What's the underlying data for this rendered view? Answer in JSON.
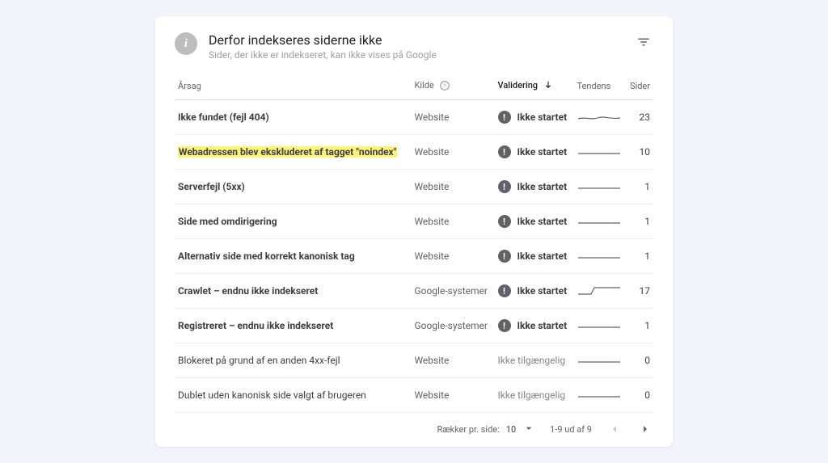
{
  "header": {
    "title": "Derfor indekseres siderne ikke",
    "subtitle": "Sider, der ikke er indekseret, kan ikke vises på Google"
  },
  "columns": {
    "reason": "Årsag",
    "source": "Kilde",
    "validation": "Validering",
    "trend": "Tendens",
    "pages": "Sider"
  },
  "status_labels": {
    "not_started": "Ikke startet",
    "na": "Ikke tilgængelig"
  },
  "sources": {
    "website": "Website",
    "google": "Google-systemer"
  },
  "rows": [
    {
      "reason": "Ikke fundet (fejl 404)",
      "bold": true,
      "highlight": false,
      "source": "website",
      "status": "not_started",
      "trend": "wavy",
      "pages": 23
    },
    {
      "reason": "Webadressen blev ekskluderet af tagget \"noindex\"",
      "bold": true,
      "highlight": true,
      "source": "website",
      "status": "not_started",
      "trend": "flat",
      "pages": 10
    },
    {
      "reason": "Serverfejl (5xx)",
      "bold": true,
      "highlight": false,
      "source": "website",
      "status": "not_started",
      "trend": "flat",
      "pages": 1
    },
    {
      "reason": "Side med omdirigering",
      "bold": true,
      "highlight": false,
      "source": "website",
      "status": "not_started",
      "trend": "flat",
      "pages": 1
    },
    {
      "reason": "Alternativ side med korrekt kanonisk tag",
      "bold": true,
      "highlight": false,
      "source": "website",
      "status": "not_started",
      "trend": "flat",
      "pages": 1
    },
    {
      "reason": "Crawlet – endnu ikke indekseret",
      "bold": true,
      "highlight": false,
      "source": "google",
      "status": "not_started",
      "trend": "step",
      "pages": 17
    },
    {
      "reason": "Registreret – endnu ikke indekseret",
      "bold": true,
      "highlight": false,
      "source": "google",
      "status": "not_started",
      "trend": "flat",
      "pages": 1
    },
    {
      "reason": "Blokeret på grund af en anden 4xx-fejl",
      "bold": false,
      "highlight": false,
      "source": "website",
      "status": "na",
      "trend": "flat",
      "pages": 0
    },
    {
      "reason": "Dublet uden kanonisk side valgt af brugeren",
      "bold": false,
      "highlight": false,
      "source": "website",
      "status": "na",
      "trend": "flat",
      "pages": 0
    }
  ],
  "pager": {
    "rows_per_page_label": "Rækker pr. side:",
    "rows_per_page_value": "10",
    "range": "1-9 ud af 9"
  }
}
